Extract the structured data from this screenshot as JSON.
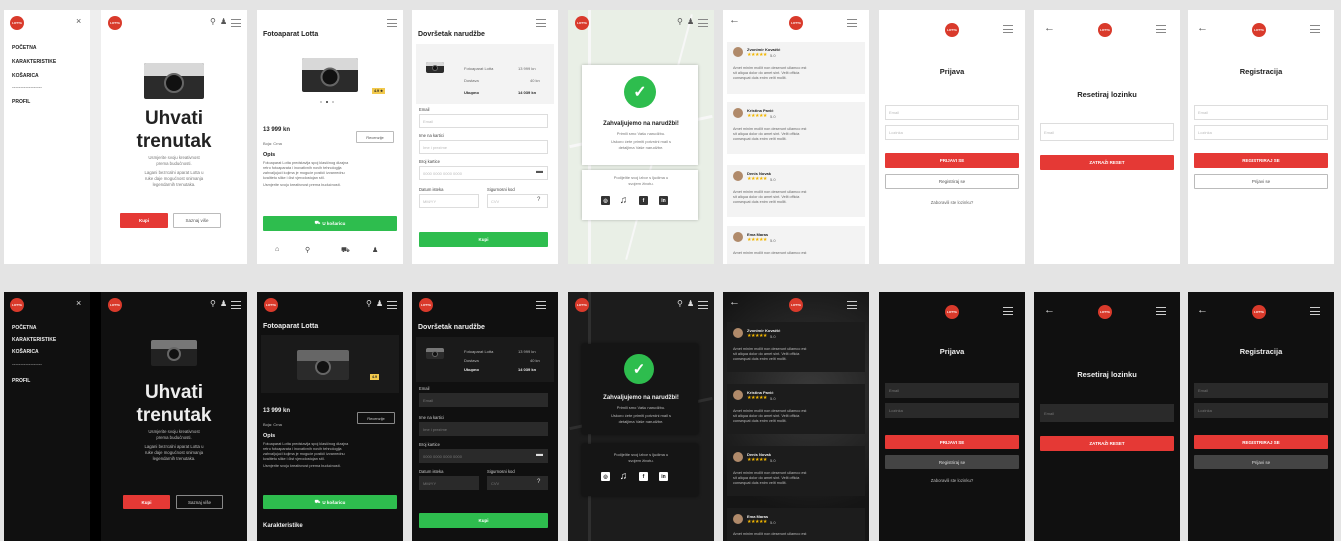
{
  "menu": {
    "items": [
      "POČETNA",
      "KARAKTERISTIKE",
      "KOŠARICA"
    ],
    "divider": "------------------",
    "profile": "PROFIL",
    "close": "×"
  },
  "brand": {
    "logo_text": "LOTTA",
    "accent": "#e53935",
    "success": "#2ebd4e"
  },
  "home": {
    "title_line1": "Uhvati",
    "title_line2": "trenutak",
    "sub1": "Usmjerite svoju kreativnost",
    "sub2": "prema budućnosti.",
    "sub3": "Lagani bezrcalni aparat Lotta u",
    "sub4": "ruke daje mogućnost snimanja",
    "sub5": "legendarnih trenutaka.",
    "buy": "Kupi",
    "more": "Saznaj više"
  },
  "product": {
    "title": "Fotoaparat Lotta",
    "rating": "4.9 ★",
    "rating_dark": "4.9",
    "price": "13 999 kn",
    "color": "Boja: Crna",
    "reviews_btn": "Recenzije",
    "desc_heading": "Opis",
    "desc1": "Fotoaparat Lotta predstavlja spoj klasičnog dizajna",
    "desc2": "retro fotoaparata i inovativnih novih tehnologija",
    "desc3": "zahvaljujući kojima je moguće postići izvanrednu",
    "desc4": "kvalitetu slike i čist vjerodostojan stil.",
    "desc5": "Usmjerite svoju kreativnost prema budućnosti.",
    "cart_btn": "U košaricu",
    "features": "Karakteristike"
  },
  "checkout": {
    "title": "Dovršetak narudžbe",
    "item_name": "Fotoaparat Lotta",
    "item_price": "13 999 kn",
    "shipping": "Dostava",
    "shipping_price": "40 kn",
    "total": "Ukupno",
    "total_price": "14 039 kn",
    "email_label": "Email",
    "email_ph": "Email",
    "name_label": "Ime na kartici",
    "name_ph": "Ime i prezime",
    "card_label": "Broj kartice",
    "card_ph": "0000 0000 0000 0000",
    "exp_label": "Datum isteka",
    "exp_ph": "MM/YY",
    "cvv_label": "Sigurnosni kod",
    "cvv_ph": "CVV",
    "buy": "Kupi"
  },
  "thanks": {
    "title": "Zahvaljujemo na narudžbi!",
    "line1": "Primili smo Vašu narudžbu.",
    "line2": "Uskoro ćete primiti potvrdni mail s",
    "line3": "detaljima Vaše narudžbe.",
    "share1": "Podijelite svoj izbor s ljudima u",
    "share2": "svojem životu."
  },
  "reviews": [
    {
      "name": "Zvonimir Kovačić",
      "rating": "5.0"
    },
    {
      "name": "Kristina Pavić",
      "rating": "5.0"
    },
    {
      "name": "Denis Novak",
      "rating": "5.0"
    },
    {
      "name": "Ema Maras",
      "rating": "5.0"
    }
  ],
  "review_text1": "Amet minim mollit non deserunt ullamco est",
  "review_text2": "sit aliqua dolor do amet sint. Velit officia",
  "review_text3": "consequat duis enim velit mollit.",
  "stars": "★★★★★",
  "login": {
    "title": "Prijava",
    "email_ph": "Email",
    "pass_ph": "Lozinka",
    "login_btn": "PRIJAVI SE",
    "register_btn": "Registriraj se",
    "forgot": "Zaboravili ste lozinku?"
  },
  "reset": {
    "title": "Resetiraj lozinku",
    "email_ph": "Email",
    "btn": "ZATRAŽI RESET"
  },
  "register": {
    "title": "Registracija",
    "email_ph": "Email",
    "pass_ph": "Lozinka",
    "reg_btn": "REGISTRIRAJ SE",
    "login_btn": "Prijavi se"
  },
  "icons": {
    "close": "×",
    "search": "⚲",
    "user": "♟",
    "home": "⌂",
    "cart": "⛟",
    "back": "←",
    "card": "▬",
    "help": "?"
  }
}
